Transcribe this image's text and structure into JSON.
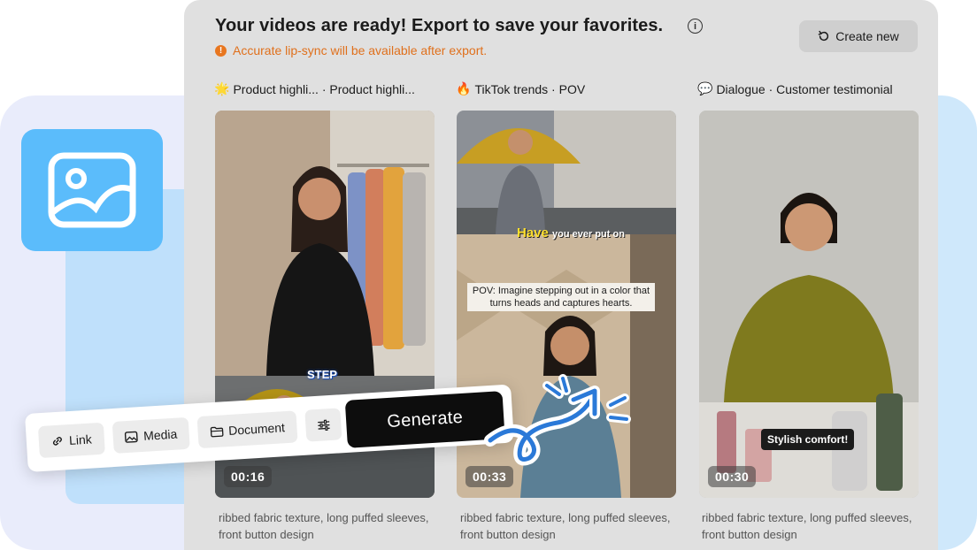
{
  "header": {
    "title": "Your videos are ready! Export to save your favorites.",
    "warning": "Accurate lip-sync will be available after export.",
    "create_label": "Create new"
  },
  "columns": [
    {
      "emoji": "🌟",
      "label": "Product highli...  · Product highli...",
      "duration": "00:16",
      "caption": "STEP",
      "description": "ribbed fabric texture, long puffed sleeves, front button design"
    },
    {
      "emoji": "🔥",
      "label": "TikTok trends · POV",
      "duration": "00:33",
      "caption_top": "Have",
      "caption_top_rest": "you ever put on",
      "caption_box": "POV: Imagine stepping out in a color that turns heads and captures hearts.",
      "description": "ribbed fabric texture, long puffed sleeves, front button design"
    },
    {
      "emoji": "💬",
      "label": "Dialogue · Customer testimonial",
      "duration": "00:30",
      "caption": "Stylish comfort!",
      "description": "ribbed fabric texture, long puffed sleeves, front button design"
    }
  ],
  "toolbar": {
    "link_label": "Link",
    "media_label": "Media",
    "document_label": "Document",
    "generate_label": "Generate"
  },
  "colors": {
    "accent_blue": "#5bbcfb",
    "warning_orange": "#e0701c",
    "generate_bg": "#0d0d0d",
    "panel_bg": "#e0e0e0"
  },
  "icons": [
    "image-icon",
    "info-icon",
    "warning-icon",
    "refresh-icon",
    "link-icon",
    "media-icon",
    "folder-icon",
    "sliders-icon",
    "arrow-doodle-icon"
  ]
}
